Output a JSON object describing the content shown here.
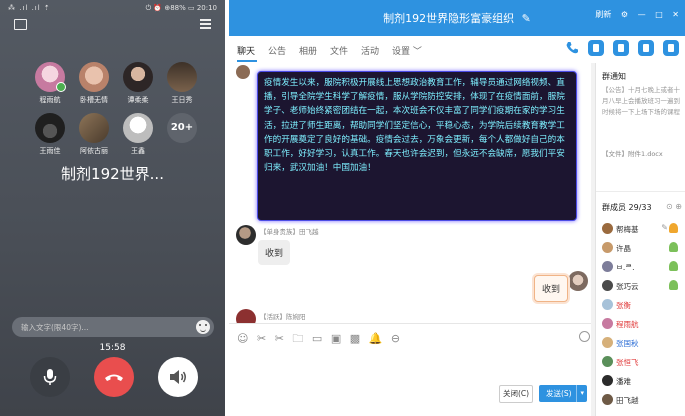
{
  "phone": {
    "status_left": "⁂ .ıl .ıl ⇡",
    "status_right": "⏻ ⏰ ⊕88% ▭ 20:10",
    "participants": [
      {
        "name": "程雨航",
        "color": "#c77aa0",
        "mic": true
      },
      {
        "name": "卧槽无情",
        "color": "#d8a890",
        "mic": false
      },
      {
        "name": "谭柔柔",
        "color": "#3a3030",
        "mic": false
      },
      {
        "name": "王日秀",
        "color": "#5b4a3c",
        "mic": false
      },
      {
        "name": "王雨佳",
        "color": "#2b2b2b",
        "mic": false
      },
      {
        "name": "阿依古丽",
        "color": "#6b5742",
        "mic": false
      },
      {
        "name": "王鑫",
        "color": "#d9d9d9",
        "mic": false
      }
    ],
    "more_count": "20+",
    "group_name": "制剂192世界...",
    "input_placeholder": "输入文字(限40字)...",
    "call_time": "15:58"
  },
  "window": {
    "title": "制剂192世界隐形富豪组织",
    "controls": [
      "刷新",
      "⚙",
      "—",
      "□",
      "✕"
    ],
    "tabs": [
      "聊天",
      "公告",
      "相册",
      "文件",
      "活动",
      "设置 ﹀"
    ]
  },
  "chat": {
    "highlight_message": "疫情发生以来，服院积极开展线上思想政治教育工作，辅导员通过网络视频、直播，引导全院学生科学了解疫情，服从学院防控安排，体现了在疫情面前，服院学子、老师始终紧密团结在一起，本次班会不仅丰富了同学们疫期在家的学习生活，拉进了师生距离，帮助同学们坚定信心，平稳心态，为学院后续教育教学工作的开展奠定了良好的基础。疫情会过去，万象会更新，每个人都做好自己的本职工作，好好学习，认真工作。春天也许会迟到，但永远不会缺席，愿我们平安归来，武汉加油！中国加油！",
    "reply1_sender": "【单身贵族】田飞越",
    "reply1_text": "收到",
    "reply2_text": "收到",
    "reply3_sender": "【活跃】陈婉阳",
    "tools": [
      "☺",
      "✂",
      "✂",
      "🗀",
      "▭",
      "▣",
      "▩",
      "🔔",
      "⊖"
    ],
    "close_label": "关闭(C)",
    "send_label": "发送(S)"
  },
  "notice": {
    "title": "群通知",
    "body": "【公告】十月七晚上或者十月八早上会播放班习一遍到时候将一下上场下场的课程",
    "file": "【文件】附件1.docx"
  },
  "members": {
    "title": "群成员 29/33",
    "list": [
      {
        "name": "帮梅基",
        "color": "#333333",
        "avatar": "#9a6a3e"
      },
      {
        "name": "许晶",
        "color": "#333333",
        "avatar": "#c79a6a"
      },
      {
        "name": "ㅂ.ᄅ.",
        "color": "#333333",
        "avatar": "#7d7d9a"
      },
      {
        "name": "张巧云",
        "color": "#333333",
        "avatar": "#4a4a4a"
      },
      {
        "name": "张衡",
        "color": "#e03b3b",
        "avatar": "#a7c2d9"
      },
      {
        "name": "程雨航",
        "color": "#e03b3b",
        "avatar": "#c77aa0"
      },
      {
        "name": "张国秋",
        "color": "#2e6fd6",
        "avatar": "#d6b07a"
      },
      {
        "name": "张恒飞",
        "color": "#e03b3b",
        "avatar": "#5a8f5a"
      },
      {
        "name": "潘难",
        "color": "#333333",
        "avatar": "#2b2b2b"
      },
      {
        "name": "田飞越",
        "color": "#333333",
        "avatar": "#6e5a46"
      }
    ]
  },
  "colors": {
    "accent": "#2e92e0",
    "hangup": "#e94e4e",
    "highlight_text": "#7ef0ff"
  }
}
